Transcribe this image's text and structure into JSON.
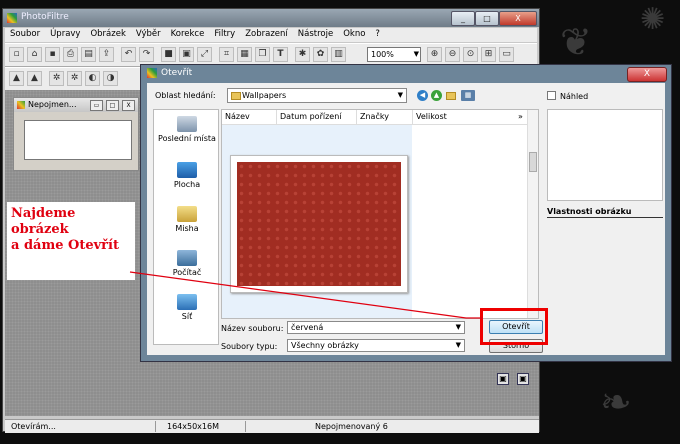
{
  "app": {
    "title": "PhotoFiltre",
    "window_controls": [
      "_",
      "□",
      "X"
    ]
  },
  "menu": [
    "Soubor",
    "Úpravy",
    "Obrázek",
    "Výběr",
    "Korekce",
    "Filtry",
    "Zobrazení",
    "Nástroje",
    "Okno",
    "?"
  ],
  "toolbar": {
    "zoom": "100%"
  },
  "document": {
    "title": "Nepojmen...",
    "controls": [
      "▭",
      "□",
      "X"
    ]
  },
  "status": {
    "left": "Otevírám...",
    "size": "164x50x16M",
    "name": "Nepojmenovaný 6"
  },
  "dialog": {
    "title": "Otevřít",
    "close": "X",
    "look_in_label": "Oblast hledání:",
    "look_in_value": "Wallpapers",
    "places": [
      "Poslední místa",
      "Plocha",
      "Misha",
      "Počítač",
      "Síť"
    ],
    "columns": [
      "Název",
      "Datum pořízení",
      "Značky",
      "Velikost"
    ],
    "more_cols": "»",
    "preview_label": "Náhled",
    "properties_label": "Vlastnosti obrázku",
    "filename_label": "Název souboru:",
    "filename_value": "červená",
    "filetype_label": "Soubory typu:",
    "filetype_value": "Všechny obrázky",
    "open_button": "Otevřít",
    "cancel_button": "Storno"
  },
  "annotation": {
    "text": "Najdeme\nobrázek\na dáme Otevřít",
    "color": "#e00010"
  }
}
